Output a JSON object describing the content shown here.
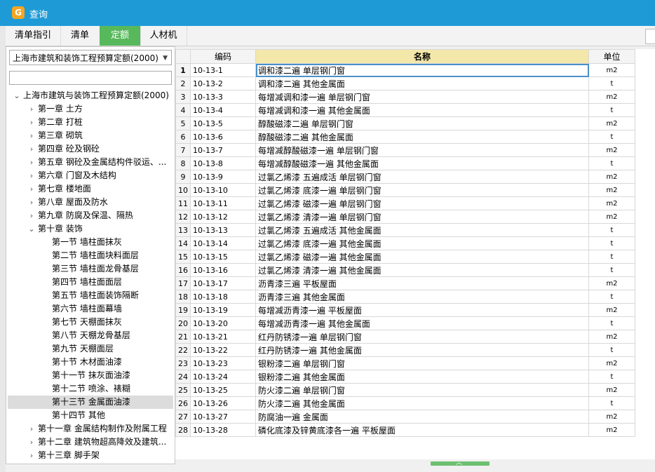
{
  "window": {
    "title": "查询",
    "icon": "app-logo-icon"
  },
  "tabs": [
    {
      "label": "清单指引",
      "active": false
    },
    {
      "label": "清单",
      "active": false
    },
    {
      "label": "定额",
      "active": true
    },
    {
      "label": "人材机",
      "active": false
    }
  ],
  "left": {
    "selector_value": "上海市建筑和装饰工程预算定额(2000)",
    "search_value": "",
    "tree": {
      "root": "上海市建筑与装饰工程预算定额(2000)",
      "chapters_before": [
        "第一章 土方",
        "第二章 打桩",
        "第三章 砌筑",
        "第四章 砼及钢砼",
        "第五章 钢砼及金属结构件驳运、...",
        "第六章 门窗及木结构",
        "第七章 楼地面",
        "第八章 屋面及防水",
        "第九章 防腐及保温、隔热"
      ],
      "open_chapter": "第十章 装饰",
      "sections": [
        "第一节 墙柱面抹灰",
        "第二节 墙柱面块料面层",
        "第三节 墙柱面龙骨基层",
        "第四节 墙柱面面层",
        "第五节 墙柱面装饰隔断",
        "第六节 墙柱面幕墙",
        "第七节 天棚面抹灰",
        "第八节 天棚龙骨基层",
        "第九节 天棚面层",
        "第十节 木材面油漆",
        "第十一节 抹灰面油漆",
        "第十二节 喷涂、裱糊",
        "第十三节 金属面油漆",
        "第十四节 其他"
      ],
      "selected_section": "第十三节 金属面油漆",
      "chapters_after": [
        "第十一章 金属结构制作及附属工程",
        "第十二章 建筑物超高降效及建筑...",
        "第十三章 脚手架"
      ]
    }
  },
  "grid": {
    "headers": {
      "code": "编码",
      "name": "名称",
      "unit": "单位"
    },
    "rows": [
      {
        "n": "1",
        "code": "10-13-1",
        "name": "调和漆二遍 单层钢门窗",
        "unit": "m2"
      },
      {
        "n": "2",
        "code": "10-13-2",
        "name": "调和漆二遍 其他金属面",
        "unit": "t"
      },
      {
        "n": "3",
        "code": "10-13-3",
        "name": "每增减调和漆一遍 单层钢门窗",
        "unit": "m2"
      },
      {
        "n": "4",
        "code": "10-13-4",
        "name": "每增减调和漆一遍 其他金属面",
        "unit": "t"
      },
      {
        "n": "5",
        "code": "10-13-5",
        "name": "醇酸磁漆二遍 单层钢门窗",
        "unit": "m2"
      },
      {
        "n": "6",
        "code": "10-13-6",
        "name": "醇酸磁漆二遍 其他金属面",
        "unit": "t"
      },
      {
        "n": "7",
        "code": "10-13-7",
        "name": "每增减醇酸磁漆一遍 单层钢门窗",
        "unit": "m2"
      },
      {
        "n": "8",
        "code": "10-13-8",
        "name": "每增减醇酸磁漆一遍 其他金属面",
        "unit": "t"
      },
      {
        "n": "9",
        "code": "10-13-9",
        "name": "过氯乙烯漆 五遍成活 单层钢门窗",
        "unit": "m2"
      },
      {
        "n": "10",
        "code": "10-13-10",
        "name": "过氯乙烯漆 底漆一遍 单层钢门窗",
        "unit": "m2"
      },
      {
        "n": "11",
        "code": "10-13-11",
        "name": "过氯乙烯漆 磁漆一遍 单层钢门窗",
        "unit": "m2"
      },
      {
        "n": "12",
        "code": "10-13-12",
        "name": "过氯乙烯漆 清漆一遍 单层钢门窗",
        "unit": "m2"
      },
      {
        "n": "13",
        "code": "10-13-13",
        "name": "过氯乙烯漆 五遍成活 其他金属面",
        "unit": "t"
      },
      {
        "n": "14",
        "code": "10-13-14",
        "name": "过氯乙烯漆 底漆一遍 其他金属面",
        "unit": "t"
      },
      {
        "n": "15",
        "code": "10-13-15",
        "name": "过氯乙烯漆 磁漆一遍 其他金属面",
        "unit": "t"
      },
      {
        "n": "16",
        "code": "10-13-16",
        "name": "过氯乙烯漆 清漆一遍 其他金属面",
        "unit": "t"
      },
      {
        "n": "17",
        "code": "10-13-17",
        "name": "沥青漆三遍 平板屋面",
        "unit": "m2"
      },
      {
        "n": "18",
        "code": "10-13-18",
        "name": "沥青漆三遍 其他金属面",
        "unit": "t"
      },
      {
        "n": "19",
        "code": "10-13-19",
        "name": "每增减沥青漆一遍 平板屋面",
        "unit": "m2"
      },
      {
        "n": "20",
        "code": "10-13-20",
        "name": "每增减沥青漆一遍 其他金属面",
        "unit": "t"
      },
      {
        "n": "21",
        "code": "10-13-21",
        "name": "红丹防锈漆一遍 单层钢门窗",
        "unit": "m2"
      },
      {
        "n": "22",
        "code": "10-13-22",
        "name": "红丹防锈漆一遍 其他金属面",
        "unit": "t"
      },
      {
        "n": "23",
        "code": "10-13-23",
        "name": "银粉漆二遍 单层钢门窗",
        "unit": "m2"
      },
      {
        "n": "24",
        "code": "10-13-24",
        "name": "银粉漆二遍 其他金属面",
        "unit": "t"
      },
      {
        "n": "25",
        "code": "10-13-25",
        "name": "防火漆二遍 单层钢门窗",
        "unit": "m2"
      },
      {
        "n": "26",
        "code": "10-13-26",
        "name": "防火漆二遍 其他金属面",
        "unit": "t"
      },
      {
        "n": "27",
        "code": "10-13-27",
        "name": "防腐油一遍 金属面",
        "unit": "m2"
      },
      {
        "n": "28",
        "code": "10-13-28",
        "name": "磷化底漆及锌黄底漆各一遍 平板屋面",
        "unit": "m2"
      }
    ]
  },
  "colors": {
    "titlebar": "#1e9bd7",
    "active_tab": "#58b85c",
    "name_header": "#f3e7a9"
  }
}
